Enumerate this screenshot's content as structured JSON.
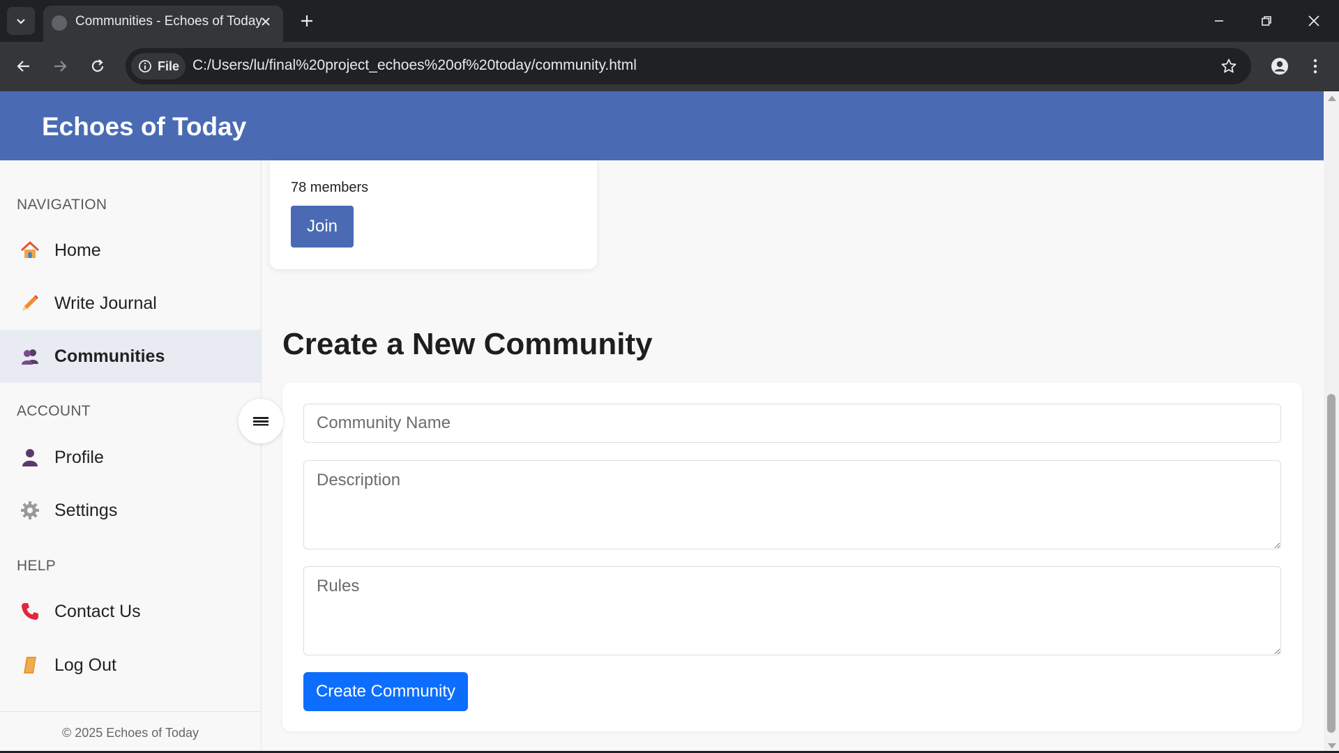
{
  "browser": {
    "tab_title": "Communities - Echoes of Today",
    "site_chip_label": "File",
    "url": "C:/Users/lu/final%20project_echoes%20of%20today/community.html"
  },
  "header": {
    "site_title": "Echoes of Today"
  },
  "sidebar": {
    "sections": {
      "navigation": "NAVIGATION",
      "account": "ACCOUNT",
      "help": "HELP"
    },
    "items": [
      {
        "label": "Home",
        "icon": "home-icon",
        "active": false
      },
      {
        "label": "Write Journal",
        "icon": "pencil-icon",
        "active": false
      },
      {
        "label": "Communities",
        "icon": "users-icon",
        "active": true
      },
      {
        "label": "Profile",
        "icon": "user-icon",
        "active": false
      },
      {
        "label": "Settings",
        "icon": "gear-icon",
        "active": false
      },
      {
        "label": "Contact Us",
        "icon": "phone-icon",
        "active": false
      },
      {
        "label": "Log Out",
        "icon": "logout-icon",
        "active": false
      }
    ],
    "footer": "© 2025 Echoes of Today"
  },
  "community_card": {
    "members": "78 members",
    "join_label": "Join"
  },
  "create_form": {
    "heading": "Create a New Community",
    "name_placeholder": "Community Name",
    "description_placeholder": "Description",
    "rules_placeholder": "Rules",
    "submit_label": "Create Community"
  },
  "colors": {
    "header": "#4a6bb4",
    "join_button": "#4a6bb4",
    "submit_button": "#0d6efd",
    "active_nav": "#e8ebf2"
  }
}
